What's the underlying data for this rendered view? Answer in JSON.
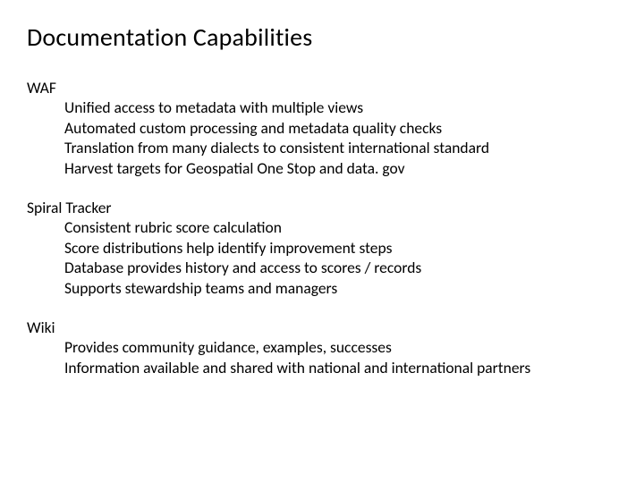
{
  "title": "Documentation Capabilities",
  "sections": [
    {
      "heading": "WAF",
      "items": [
        "Unified access to metadata with multiple views",
        "Automated custom processing and metadata quality checks",
        "Translation from many dialects to consistent international standard",
        "Harvest targets for Geospatial One Stop and data. gov"
      ]
    },
    {
      "heading": "Spiral Tracker",
      "items": [
        "Consistent rubric score calculation",
        "Score distributions help identify improvement steps",
        "Database provides history and access to scores / records",
        "Supports stewardship teams and managers"
      ]
    },
    {
      "heading": "Wiki",
      "items": [
        "Provides community guidance, examples, successes",
        "Information available and shared with national and international partners"
      ]
    }
  ]
}
